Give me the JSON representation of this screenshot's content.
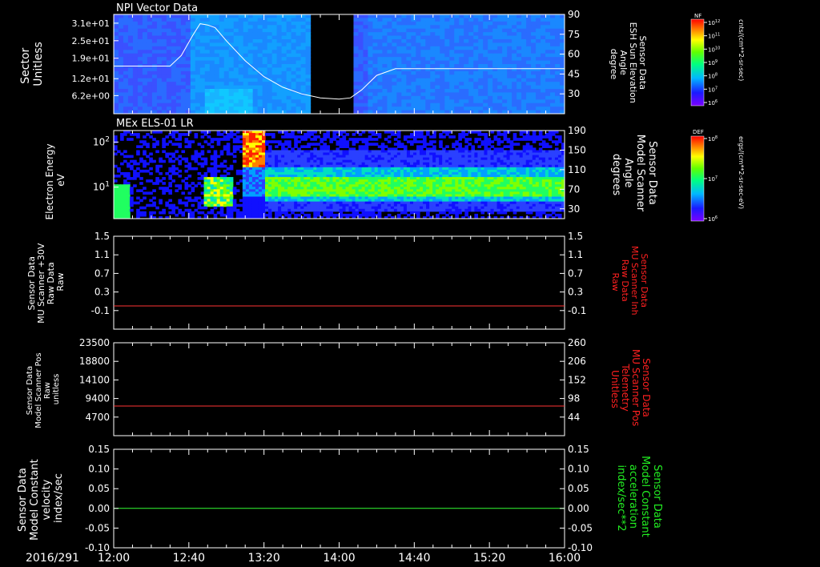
{
  "colors": {
    "background": "#000000",
    "axis": "#ffffff",
    "red_trace": "#ff3333",
    "green_trace": "#33ff33",
    "sun_curve": "#ffffff",
    "right_label_red": "#ff2020",
    "right_label_green": "#22ee22"
  },
  "chart_data": [
    {
      "type": "heatmap",
      "title": "NPI Vector Data",
      "ylabel": [
        "Sector",
        "Unitless"
      ],
      "yticks": [
        "3.1e+01",
        "2.5e+01",
        "1.9e+01",
        "1.2e+01",
        "6.2e+00"
      ],
      "ytick_values": [
        31,
        25,
        19,
        12,
        6.2
      ],
      "ylim": [
        0,
        34
      ],
      "right_label": [
        "Sensor Data",
        "ESH Sun Elevation",
        "Angle",
        "degree"
      ],
      "right_ticks": [
        "90",
        "75",
        "60",
        "45",
        "30"
      ],
      "right_tick_values": [
        90,
        75,
        60,
        45,
        30
      ],
      "right_ylim": [
        15,
        90
      ],
      "data_gap": {
        "start": "13:46",
        "end": "14:06"
      },
      "overlay_line": {
        "name": "ESH Sun Elevation",
        "x": [
          "12:00",
          "12:30",
          "12:36",
          "12:42",
          "12:46",
          "12:50",
          "12:54",
          "13:00",
          "13:10",
          "13:20",
          "13:30",
          "13:40",
          "13:50",
          "14:00",
          "14:06",
          "14:12",
          "14:20",
          "14:30",
          "16:00"
        ],
        "y": [
          51,
          51,
          59,
          74,
          83,
          82,
          80,
          70,
          55,
          43,
          35,
          30,
          27,
          26,
          27,
          33,
          44,
          49,
          49
        ]
      },
      "colorbar": {
        "label": "NF",
        "units": "cnts/(cm**2-sr-sec)",
        "ticks": [
          "10^12",
          "10^11",
          "10^10",
          "10^9",
          "10^8",
          "10^7",
          "10^6"
        ]
      }
    },
    {
      "type": "heatmap",
      "title": "MEx ELS-01 LR",
      "ylabel": [
        "Electron Energy",
        "eV"
      ],
      "yscale": "log",
      "yticks": [
        "10^2",
        "10^1"
      ],
      "ylim": [
        2,
        180
      ],
      "right_label": [
        "Sensor Data",
        "Model Scanner",
        "Angle",
        "degrees"
      ],
      "right_ticks": [
        "190",
        "150",
        "110",
        "70",
        "30"
      ],
      "right_tick_values": [
        190,
        150,
        110,
        70,
        30
      ],
      "colorbar": {
        "label": "DEF",
        "units": "ergs/(cm**2-sr-sec-eV)",
        "ticks": [
          "10^8",
          "10^7",
          "10^6"
        ]
      }
    },
    {
      "type": "line",
      "ylabel": [
        "Sensor Data",
        "MU Scanner +30V",
        "Raw Data",
        "Raw"
      ],
      "yticks": [
        "1.5",
        "1.1",
        "0.7",
        "0.3",
        "-0.1"
      ],
      "ylim": [
        -0.5,
        1.5
      ],
      "right_label": [
        "Sensor Data",
        "MU Scanner Inh",
        "Raw Data",
        "Raw"
      ],
      "right_ticks": [
        "1.5",
        "1.1",
        "0.7",
        "0.3",
        "-0.1"
      ],
      "series": [
        {
          "color": "red",
          "x": [
            "12:00",
            "16:00"
          ],
          "y": [
            0.0,
            0.0
          ]
        }
      ]
    },
    {
      "type": "line",
      "ylabel": [
        "Sensor Data",
        "Model Scanner Pos",
        "Raw",
        "unitless"
      ],
      "yticks": [
        "23500",
        "18800",
        "14100",
        "9400",
        "4700"
      ],
      "ylim": [
        0,
        23500
      ],
      "right_label": [
        "Sensor Data",
        "MU Scanner Pos",
        "Telemetry",
        "Unitless"
      ],
      "right_ticks": [
        "260",
        "206",
        "152",
        "98",
        "44"
      ],
      "series": [
        {
          "color": "red",
          "x": [
            "12:00",
            "16:00"
          ],
          "y": [
            7500,
            7500
          ]
        }
      ]
    },
    {
      "type": "line",
      "ylabel": [
        "Sensor Data",
        "Model Constant",
        "velocity",
        "index/sec"
      ],
      "yticks": [
        "0.15",
        "0.10",
        "0.05",
        "0.00",
        "-0.05",
        "-0.10"
      ],
      "ylim": [
        -0.1,
        0.15
      ],
      "right_label": [
        "Sensor Data",
        "Model Constant",
        "acceleration",
        "index/sec**2"
      ],
      "right_ticks": [
        "0.15",
        "0.10",
        "0.05",
        "0.00",
        "-0.05",
        "-0.10"
      ],
      "series": [
        {
          "color": "green",
          "x": [
            "12:00",
            "16:00"
          ],
          "y": [
            0.0,
            0.0
          ]
        }
      ]
    }
  ],
  "time_axis": {
    "date_label": "2016/291",
    "ticks": [
      "12:00",
      "12:40",
      "13:20",
      "14:00",
      "14:40",
      "15:20",
      "16:00"
    ],
    "start": "12:00",
    "end": "16:00"
  }
}
